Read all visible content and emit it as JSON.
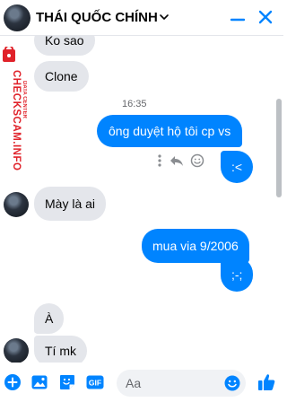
{
  "header": {
    "title": "THÁI QUỐC CHÍNH"
  },
  "watermark": {
    "line1": "DATA CENTER",
    "line2": "CHECKSCAM.INFO"
  },
  "messages": [
    {
      "side": "in",
      "text": "Ko sao"
    },
    {
      "side": "in",
      "text": "Clone"
    },
    {
      "side": "time",
      "text": "16:35"
    },
    {
      "side": "out",
      "text": "ông duyệt hộ tôi cp  vs"
    },
    {
      "side": "out",
      "text": ":<"
    },
    {
      "side": "in",
      "text": "Mày là ai"
    },
    {
      "side": "out",
      "text": "mua via 9/2006"
    },
    {
      "side": "out",
      "text": ";-;"
    },
    {
      "side": "in",
      "text": "À"
    },
    {
      "side": "in",
      "text": "Tí mk"
    }
  ],
  "composer": {
    "placeholder": "Aa",
    "gif_label": "GIF"
  },
  "colors": {
    "accent": "#0084ff",
    "incoming_bubble": "#e4e6eb",
    "watermark": "#e0222a"
  },
  "icons": [
    "chevron-down-icon",
    "minimize-icon",
    "close-icon",
    "more-vertical-icon",
    "reply-icon",
    "smile-icon",
    "plus-circle-icon",
    "image-icon",
    "sticker-icon",
    "gif-icon",
    "emoji-icon",
    "thumbs-up-icon"
  ]
}
